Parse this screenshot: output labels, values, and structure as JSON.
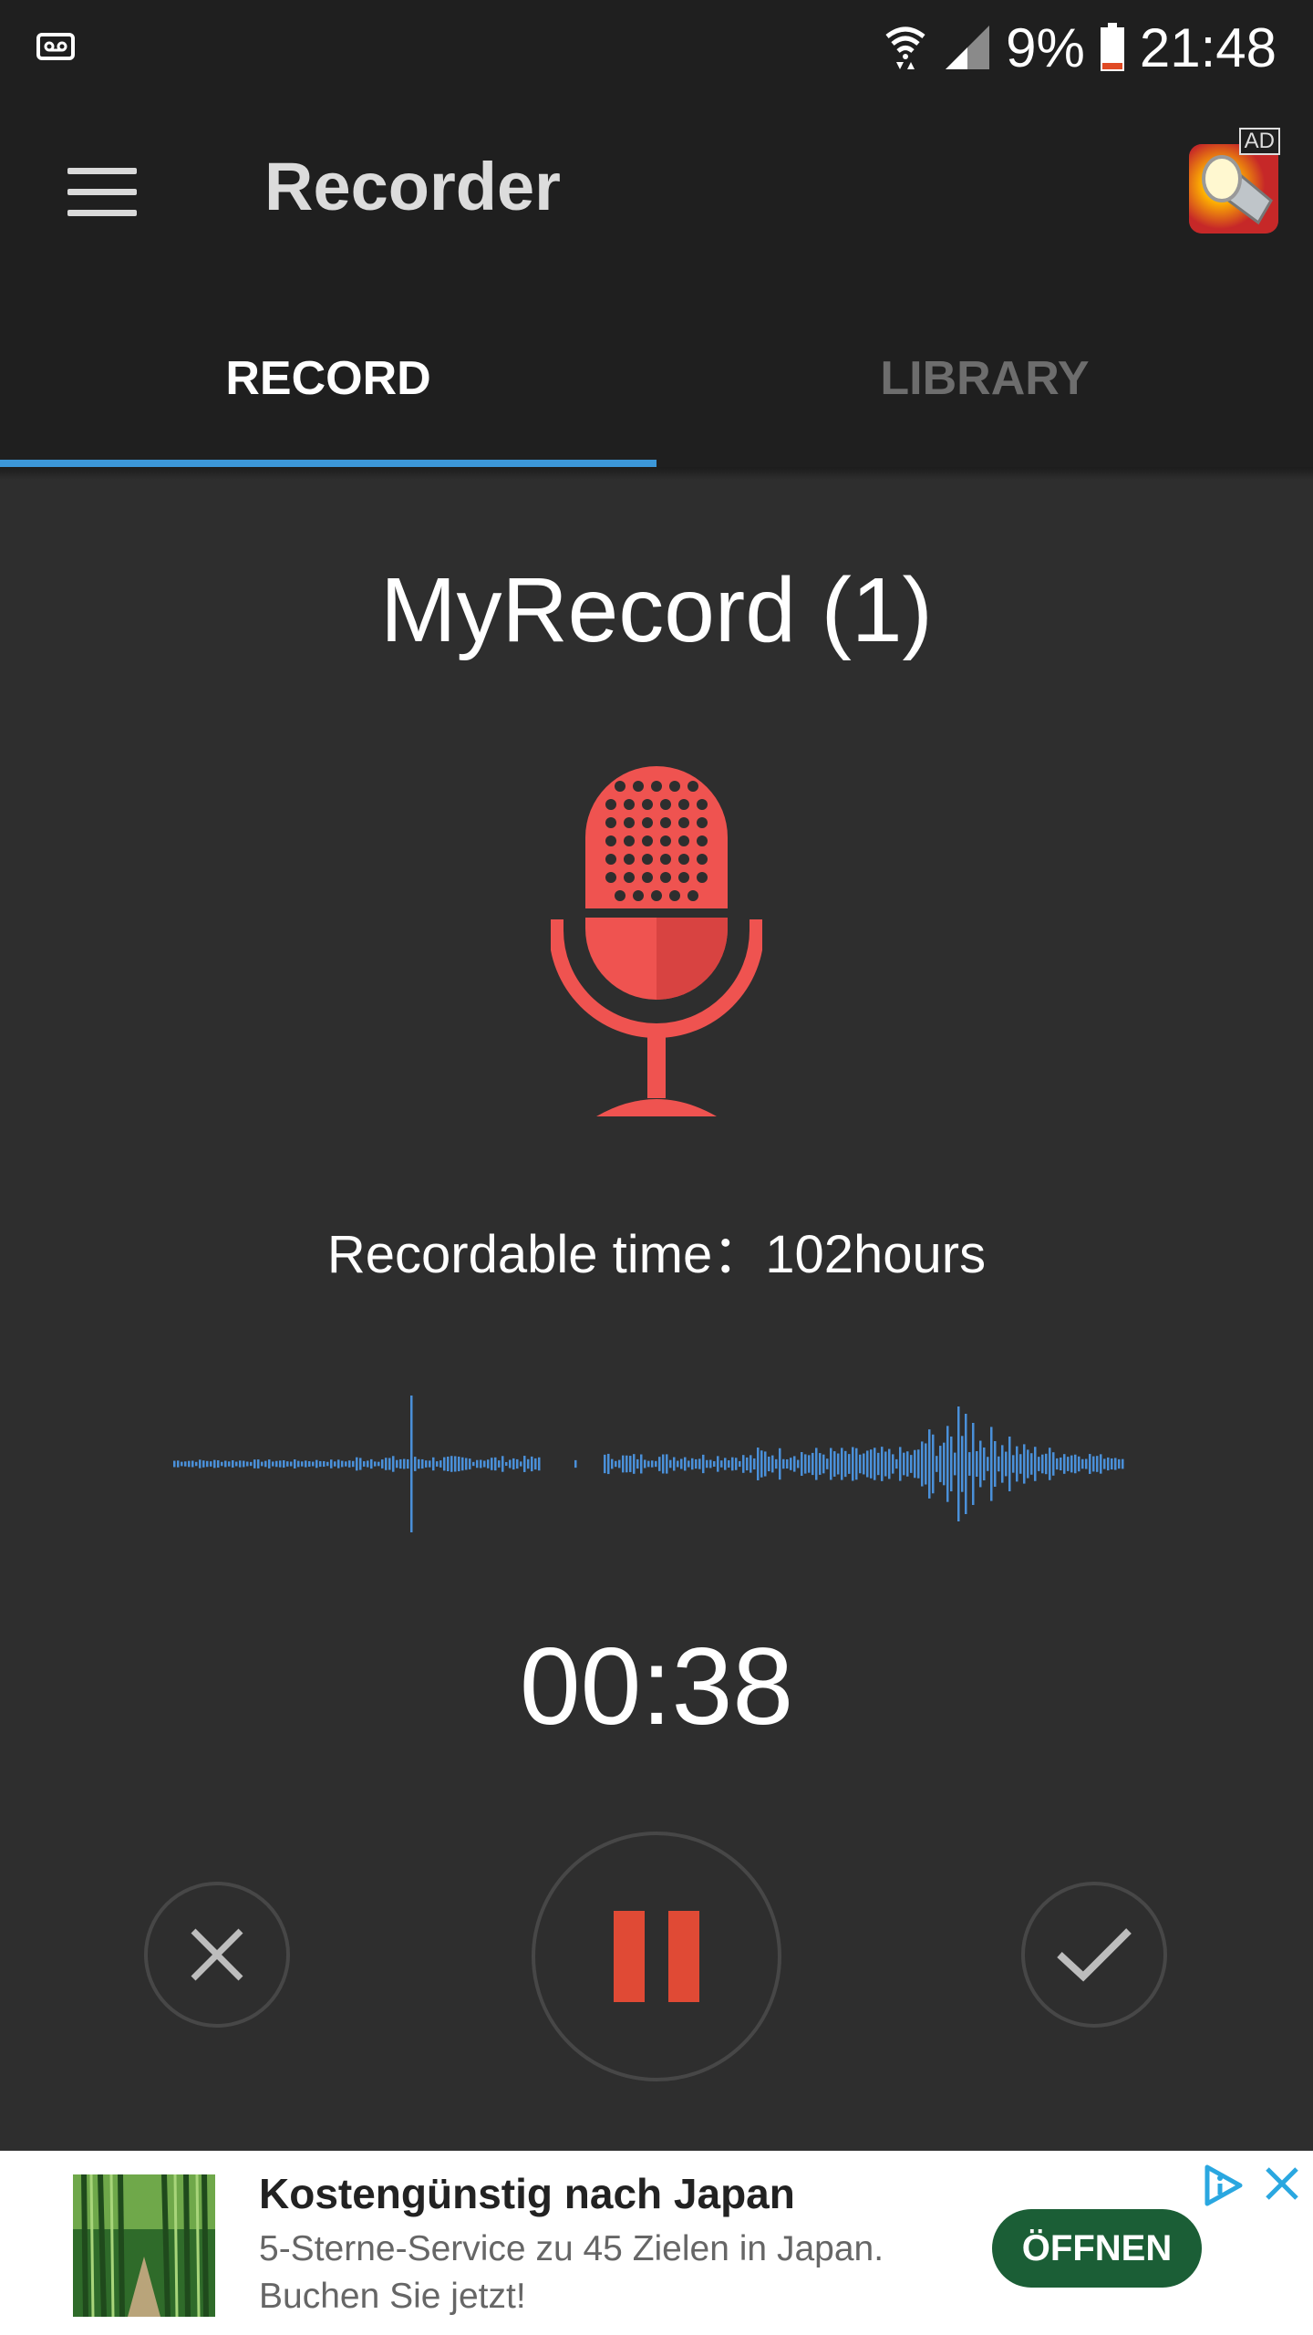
{
  "status_bar": {
    "battery": "9%",
    "time": "21:48",
    "icons": [
      "voicemail-icon",
      "wifi-icon",
      "signal-icon",
      "battery-icon"
    ]
  },
  "app_bar": {
    "title": "Recorder",
    "ad_badge": "AD"
  },
  "tabs": [
    {
      "label": "RECORD",
      "active": true
    },
    {
      "label": "LIBRARY",
      "active": false
    }
  ],
  "recording": {
    "name": "MyRecord (1)",
    "recordable_time": "Recordable time：102hours",
    "elapsed": "00:38",
    "accent_color": "#e04a35",
    "mic_color": "#ef5350",
    "waveform_color": "#4a90d9"
  },
  "controls": {
    "cancel_icon": "close-icon",
    "pause_icon": "pause-icon",
    "done_icon": "check-icon"
  },
  "ad": {
    "headline": "Kostengünstig nach Japan",
    "body": "5-Sterne-Service zu 45 Zielen in Japan. Buchen Sie jetzt!",
    "cta": "ÖFFNEN"
  }
}
